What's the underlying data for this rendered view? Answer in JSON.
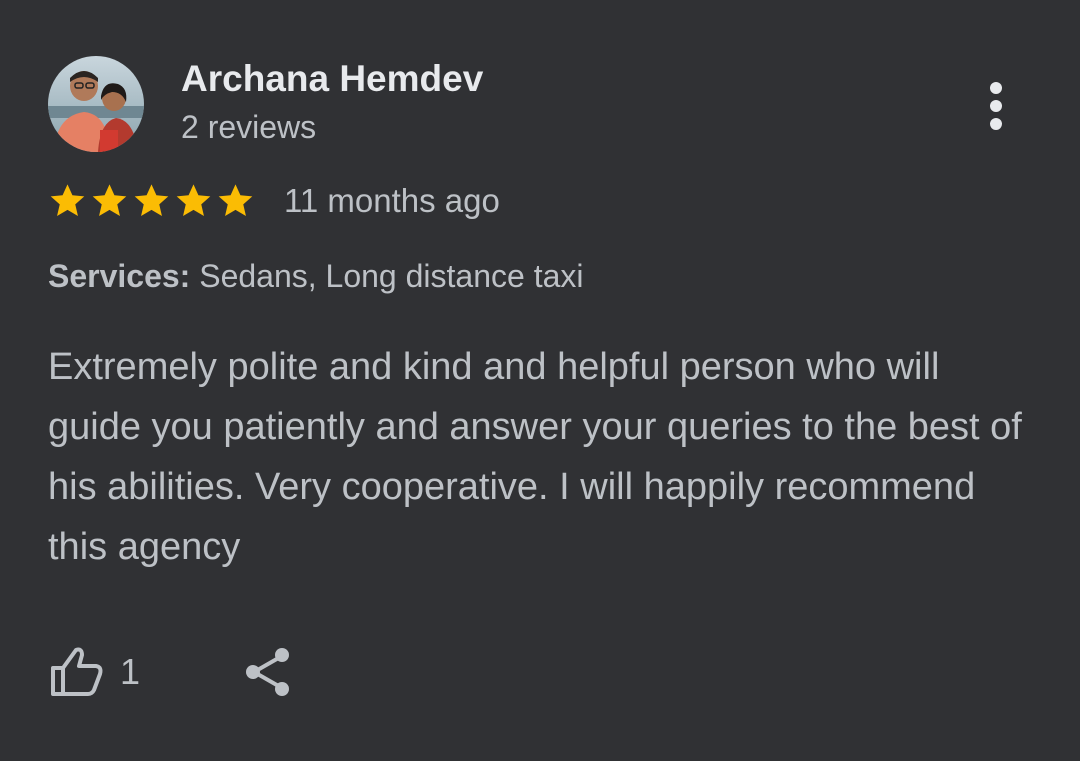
{
  "reviewer": {
    "name": "Archana Hemdev",
    "review_count": "2 reviews",
    "avatar_icon": "profile-photo"
  },
  "menu": {
    "icon": "more-vert-icon"
  },
  "rating": {
    "stars": 5,
    "max_stars": 5,
    "star_color": "#fbbc04",
    "time_ago": "11 months ago"
  },
  "services": {
    "label": "Services:",
    "value": "Sedans, Long distance taxi"
  },
  "review": {
    "text": "Extremely polite and kind and helpful person who will guide you patiently and answer your queries to the best of his abilities. Very cooperative. I will happily recommend this agency"
  },
  "actions": {
    "like_icon": "thumbs-up-icon",
    "like_count": "1",
    "share_icon": "share-icon"
  },
  "colors": {
    "background": "#303134",
    "name": "#e8eaed",
    "text": "#bdc1c6"
  }
}
